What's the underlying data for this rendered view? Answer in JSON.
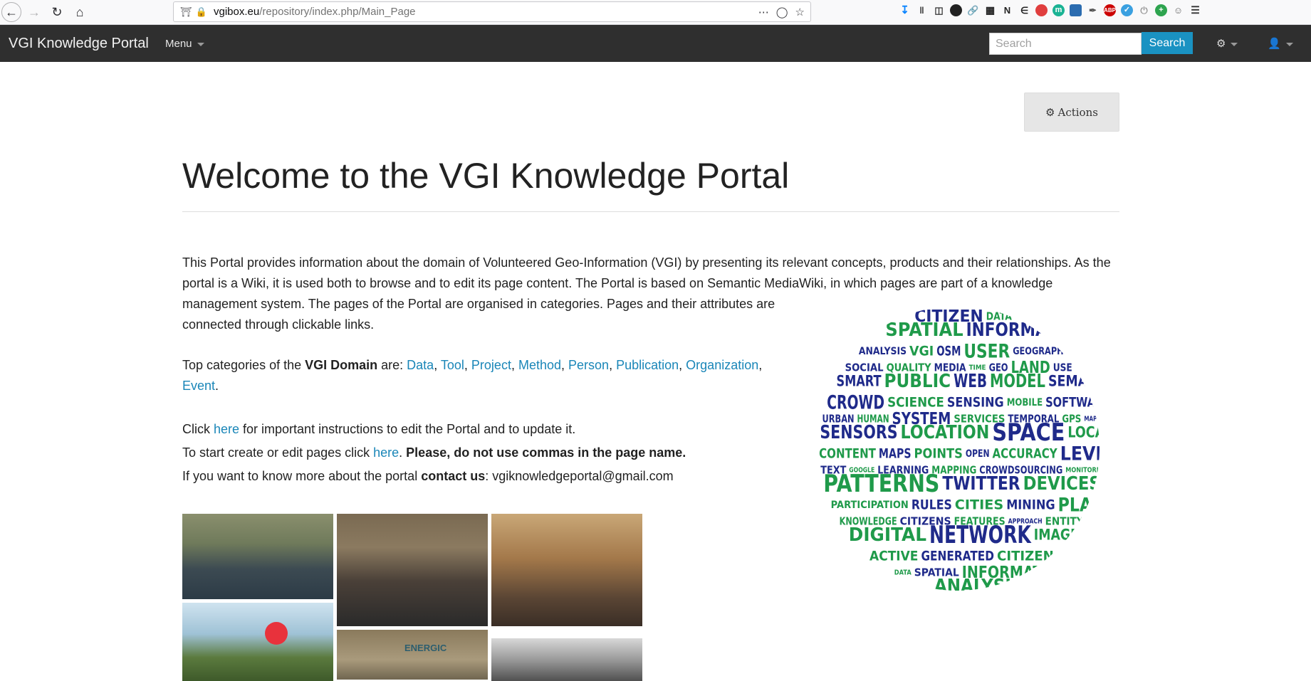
{
  "browser": {
    "url_host": "vgibox.eu",
    "url_path": "/repository/index.php/Main_Page"
  },
  "navbar": {
    "brand": "VGI Knowledge Portal",
    "menu_label": "Menu",
    "search_placeholder": "Search",
    "search_button": "Search"
  },
  "actions": {
    "label": "Actions"
  },
  "page": {
    "title": "Welcome to the VGI Knowledge Portal",
    "intro_1": "This Portal provides information about the domain of Volunteered Geo-Information (VGI) by presenting its relevant concepts, products and their relationships. As the portal is a Wiki, it is used both to browse and to edit its page content. The Portal is based on Semantic MediaWiki, in which pages are part of a knowledge",
    "intro_2": "management system. The pages of the Portal are organised in categories. Pages and their attributes are connected through clickable links.",
    "cats_prefix": "Top categories of the ",
    "cats_domain": "VGI Domain",
    "cats_are": " are: ",
    "categories": [
      "Data",
      "Tool",
      "Project",
      "Method",
      "Person",
      "Publication",
      "Organization",
      "Event"
    ],
    "click_prefix": "Click ",
    "here_1": "here",
    "click_suffix": " for important instructions to edit the Portal and to update it.",
    "start_prefix": "To start create or edit pages click ",
    "here_2": "here",
    "start_period": ".",
    "start_warning": " Please, do not use commas in the page name.",
    "contact_prefix": "If you want to know more about the portal ",
    "contact_us": "contact us",
    "contact_email": ": vgiknowledgeportal@gmail.com"
  },
  "word_cloud": {
    "words": [
      "CITIZEN",
      "DATA",
      "SPATIAL",
      "INFORMATION",
      "ANALYSIS",
      "VGI",
      "OSM",
      "USER",
      "GEOGRAPHIC",
      "SOCIAL",
      "QUALITY",
      "MEDIA",
      "TIME",
      "GEO",
      "LAND",
      "USE",
      "SMART",
      "PUBLIC",
      "WEB",
      "MODEL",
      "SEMANTIC",
      "CROWD",
      "SCIENCE",
      "SENSING",
      "MOBILE",
      "SOFTWARE",
      "URBAN",
      "HUMAN",
      "SYSTEM",
      "SERVICES",
      "TEMPORAL",
      "GPS",
      "MAP",
      "SENSORS",
      "LOCATION",
      "SPACE",
      "LOCAL",
      "CONTENT",
      "MAPS",
      "POINTS",
      "OPEN",
      "ACCURACY",
      "LEVEL",
      "TEXT",
      "GOOGLE",
      "LEARNING",
      "MAPPING",
      "CROWDSOURCING",
      "MONITORING",
      "PATTERNS",
      "TWITTER",
      "DEVICES",
      "PARTICIPATION",
      "RULES",
      "CITIES",
      "MINING",
      "PLANNING",
      "KNOWLEDGE",
      "CITIZENS",
      "FEATURES",
      "APPROACH",
      "ENTITY",
      "DIGITAL",
      "NETWORK",
      "IMAGES",
      "ACTIVE",
      "GENERATED"
    ],
    "colors": {
      "blue": "#1f2a8a",
      "green": "#1f9a4a"
    }
  }
}
